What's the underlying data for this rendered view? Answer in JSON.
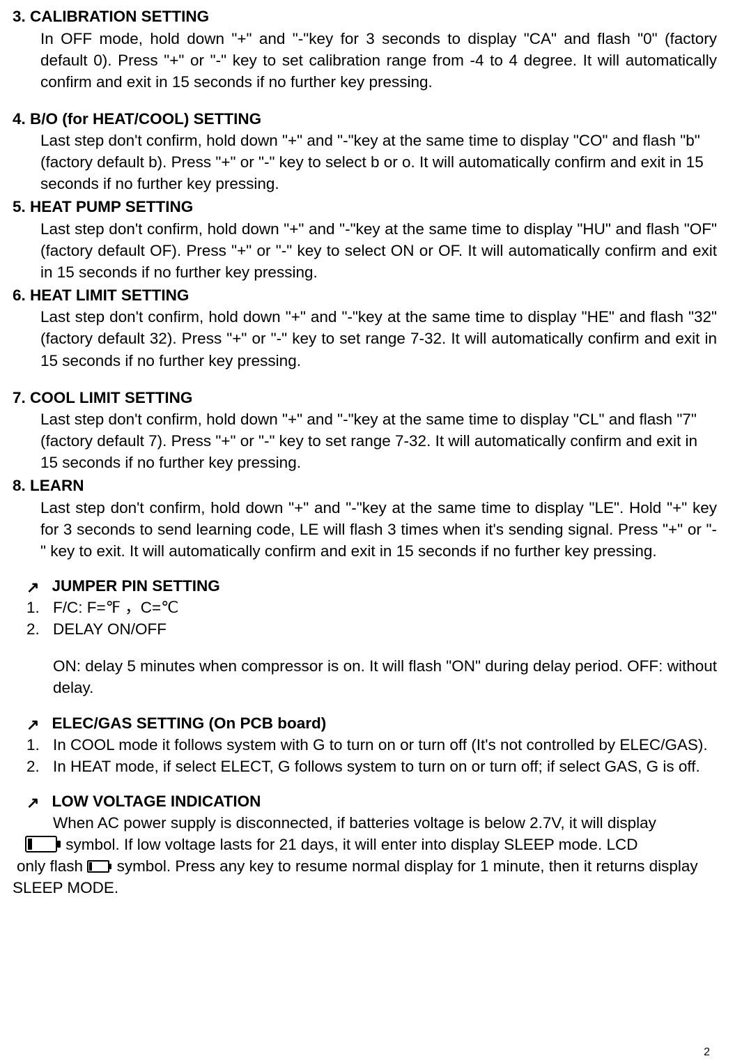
{
  "s3": {
    "heading": "3. CALIBRATION SETTING",
    "body": "In OFF mode, hold down \"+\" and \"-\"key for 3 seconds to display \"CA\" and flash \"0\" (factory default 0). Press \"+\" or \"-\" key to set calibration range from -4 to 4 degree. It will automatically confirm and exit in 15 seconds if no further key pressing."
  },
  "s4": {
    "heading": "4. B/O (for HEAT/COOL) SETTING",
    "body": "Last step don't confirm, hold down \"+\" and \"-\"key at the same time to display \"CO\" and flash \"b\" (factory default b). Press \"+\" or \"-\" key to select b or o. It will automatically confirm and exit in 15 seconds if no further key pressing."
  },
  "s5": {
    "heading": "5. HEAT PUMP SETTING",
    "body": "Last step don't confirm, hold down \"+\" and \"-\"key at the same time to display \"HU\" and flash \"OF\" (factory default OF). Press  \"+\" or \"-\" key to select ON or OF. It will automatically confirm and exit in 15 seconds if no further key pressing."
  },
  "s6": {
    "heading": "6. HEAT LIMIT SETTING",
    "body": "Last step don't confirm, hold down \"+\" and \"-\"key at the same time to display \"HE\" and flash \"32\" (factory default 32). Press \"+\" or \"-\" key to set range 7-32. It will automatically confirm and exit in 15 seconds if no further key pressing."
  },
  "s7": {
    "heading": "7. COOL LIMIT SETTING",
    "body": "Last step don't confirm, hold down \"+\" and \"-\"key at the same time to display \"CL\" and flash \"7\" (factory default 7). Press \"+\" or \"-\" key to set range 7-32. It will automatically confirm and exit in 15 seconds if no further key pressing."
  },
  "s8": {
    "heading": "8. LEARN",
    "body": "Last step don't confirm, hold down \"+\" and \"-\"key at the same time to display \"LE\". Hold \"+\" key for 3 seconds to send learning code, LE will flash 3 times when it's sending signal. Press \"+\" or \"-\" key to exit. It will automatically confirm and exit in 15 seconds if no further key pressing."
  },
  "jumper": {
    "label": "JUMPER PIN SETTING",
    "item1_num": "1.",
    "item1_txt": "F/C: F=℉ ，C=℃",
    "item2_num": "2.",
    "item2_txt": "DELAY ON/OFF",
    "item2_sub": "ON: delay 5 minutes when compressor is on. It will flash \"ON\" during delay period. OFF: without delay."
  },
  "elec": {
    "label": "ELEC/GAS SETTING (On PCB board)",
    "item1_num": "1.",
    "item1_txt": "In COOL mode it follows system with G to turn on or turn off (It's not controlled by ELEC/GAS).",
    "item2_num": "2.",
    "item2_txt": "In HEAT mode, if select ELECT, G follows system to turn on or turn off; if select GAS, G is off."
  },
  "lowvolt": {
    "label": "LOW VOLTAGE INDICATION",
    "line1": "When AC power supply is disconnected, if batteries voltage is below 2.7V, it will display",
    "line2": " symbol. If low voltage lasts for 21 days, it will enter into display SLEEP mode. LCD",
    "line3a": " only flash ",
    "line3b": " symbol. Press any key to resume normal display for 1 minute, then it returns display",
    "line4": "SLEEP MODE."
  },
  "arrow_glyph": "↗",
  "page_number": "2"
}
